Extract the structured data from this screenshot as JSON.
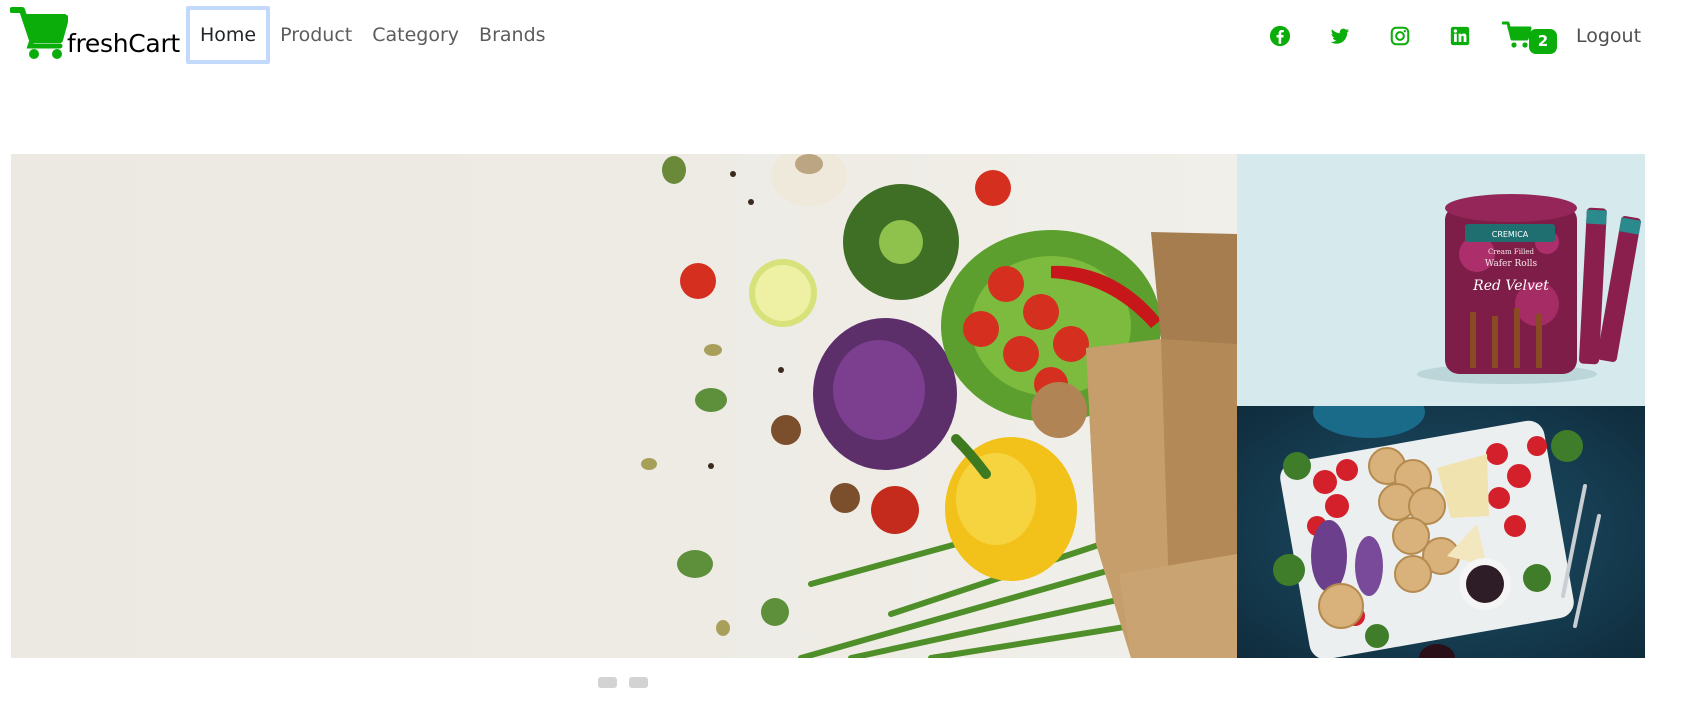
{
  "brand": {
    "name": "freshCart",
    "cart_icon": "shopping-cart-icon",
    "color": "#0aad0a"
  },
  "nav": {
    "links": [
      {
        "label": "Home",
        "active": true
      },
      {
        "label": "Product",
        "active": false
      },
      {
        "label": "Category",
        "active": false
      },
      {
        "label": "Brands",
        "active": false
      }
    ]
  },
  "header_right": {
    "socials": [
      "facebook-icon",
      "twitter-icon",
      "instagram-icon",
      "linkedin-icon"
    ],
    "cart_count": "2",
    "logout_label": "Logout"
  },
  "slider": {
    "slides_count": 2,
    "main_image": "grocery-vegetables-bag-image",
    "side_images": [
      "red-velvet-wafer-rolls-image",
      "cheese-cracker-platter-image"
    ]
  },
  "side_product": {
    "brand": "CREMICA",
    "line1": "Cream Filled",
    "line2": "Wafer Rolls",
    "flavour": "Red Velvet"
  },
  "colors": {
    "accent": "#0aad0a",
    "active_outline": "#c3d9fb"
  }
}
